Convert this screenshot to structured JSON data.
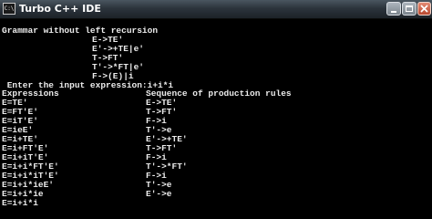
{
  "window": {
    "title": "Turbo C++ IDE",
    "icon_name": "console-app-icon",
    "icon_text": "C:\\",
    "colors": {
      "titlebar": "#2c343c",
      "console_bg": "#000000",
      "console_text": "#ececec",
      "close_button": "#c1543a"
    }
  },
  "console": {
    "heading": "Grammar without left recursion",
    "rules": [
      "E->TE'",
      "E'->+TE|e'",
      "T->FT'",
      "T'->*FT|e'",
      "F->(E)|i"
    ],
    "prompt": " Enter the input expression:i+i*i",
    "table_headers": {
      "expressions": "Expressions",
      "sequence": "Sequence of production rules"
    },
    "expressions": [
      "E=TE'",
      "E=FT'E'",
      "E=iT'E'",
      "E=ieE'",
      "E=i+TE'",
      "E=i+FT'E'",
      "E=i+iT'E'",
      "E=i+i*FT'E'",
      "E=i+i*iT'E'",
      "E=i+i*ieE'",
      "E=i+i*ie",
      "E=i+i*i"
    ],
    "productions": [
      "E->TE'",
      "T->FT'",
      "F->i",
      "T'->e",
      "E'->+TE'",
      "T->FT'",
      "F->i",
      "T'->*FT'",
      "F->i",
      "T'->e",
      "E'->e"
    ]
  }
}
